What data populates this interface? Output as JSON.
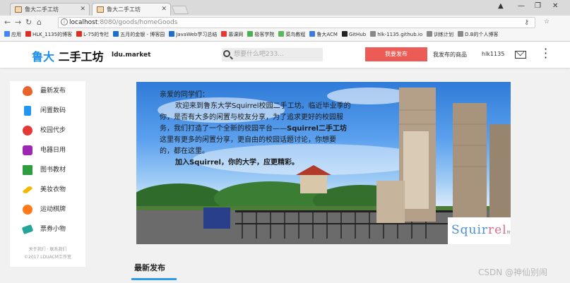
{
  "browser": {
    "tabs": [
      {
        "title": "鲁大二手工坊",
        "active": false
      },
      {
        "title": "鲁大二手工坊",
        "active": true
      }
    ],
    "url_host": "localhost",
    "url_path": ":8080/goods/homeGoods",
    "bookmarks": [
      {
        "label": "应用",
        "color": "#4285f4"
      },
      {
        "label": "HLK_1135的博客",
        "color": "#d93025"
      },
      {
        "label": "L-75的专栏",
        "color": "#d93025"
      },
      {
        "label": "五月的金银 - 博客园",
        "color": "#1d6ec9"
      },
      {
        "label": "JavaWeb学习总结",
        "color": "#1d6ec9"
      },
      {
        "label": "慕课网",
        "color": "#e33"
      },
      {
        "label": "极客学院",
        "color": "#4caf50"
      },
      {
        "label": "菜鸟教程",
        "color": "#5cb85c"
      },
      {
        "label": "鲁大ACM",
        "color": "#3b7dd8"
      },
      {
        "label": "GitHub",
        "color": "#222222"
      },
      {
        "label": "hlk-1135.github.io",
        "color": "#888888"
      },
      {
        "label": "训练计划",
        "color": "#888888"
      },
      {
        "label": "D.B的个人博客",
        "color": "#888888"
      }
    ]
  },
  "header": {
    "brand_ldu": "鲁大",
    "brand_rest": "二手工坊",
    "domain": "ldu.market",
    "search_placeholder": "想要什么吧233...",
    "publish_label": "我要发布",
    "mygoods_label": "我发布的商品",
    "username": "hlk1135"
  },
  "sidebar": {
    "items": [
      {
        "label": "最新发布",
        "icon": "fire-icon",
        "color": "#e8642c"
      },
      {
        "label": "闲置数码",
        "icon": "phone-icon",
        "color": "#2196f3"
      },
      {
        "label": "校园代步",
        "icon": "bicycle-icon",
        "color": "#e53935"
      },
      {
        "label": "电器日用",
        "icon": "camera-icon",
        "color": "#9c27b0"
      },
      {
        "label": "图书教材",
        "icon": "book-icon",
        "color": "#2e9d3f"
      },
      {
        "label": "美妆衣物",
        "icon": "lipstick-icon",
        "color": "#f5b800"
      },
      {
        "label": "运动棋牌",
        "icon": "basketball-icon",
        "color": "#ff7a1a"
      },
      {
        "label": "票券小物",
        "icon": "ticket-icon",
        "color": "#26a69a"
      }
    ],
    "footer_links": "关于我们 · 联系我们",
    "copyright": "©2017 LDUACM工作室"
  },
  "banner": {
    "greeting": "亲爱的同学们：",
    "line1": "欢迎来到鲁东大学Squirrel校园二手工坊。临近毕业季的",
    "line2": "你，是否有大多的闲置与校友分享，为了追求更好的校园服",
    "line3_pre": "务，我们打造了一个全新的校园平台——",
    "line3_bold": "Squirrel二手工坊",
    "line4": "这里有更多的闲置分享，更自由的校园话题讨论，你想要",
    "line5": "的，都在这里。",
    "slogan": "加入Squirrel，你的大学，应更精彩。",
    "logo_a": "Squir",
    "logo_b": "rel",
    "logo_small": "校版"
  },
  "section": {
    "title": "最新发布"
  },
  "watermark": "CSDN @神仙别闹"
}
